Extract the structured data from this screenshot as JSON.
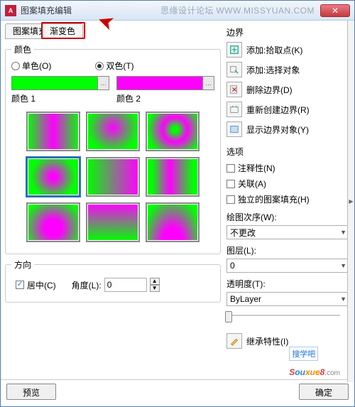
{
  "title": "图案填充编辑",
  "watermark_label": "思缘设计论坛",
  "watermark_url": "WWW.MISSYUAN.COM",
  "tabs": {
    "pattern": "图案填充",
    "gradient": "渐变色"
  },
  "color_group": {
    "legend": "颜色",
    "one_color": "单色(O)",
    "two_color": "双色(T)",
    "color1_label": "颜色 1",
    "color2_label": "颜色 2",
    "color1": "#00ff00",
    "color2": "#ff00ff"
  },
  "direction_group": {
    "legend": "方向",
    "center": "居中(C)",
    "angle_label": "角度(L):",
    "angle_value": "0"
  },
  "boundary": {
    "title": "边界",
    "add_pick": "添加:拾取点(K)",
    "add_select": "添加:选择对象",
    "remove": "删除边界(D)",
    "recreate": "重新创建边界(R)",
    "view": "显示边界对象(Y)"
  },
  "options": {
    "title": "选项",
    "annotative": "注释性(N)",
    "associative": "关联(A)",
    "separate": "独立的图案填充(H)",
    "draw_order_label": "绘图次序(W):",
    "draw_order_value": "不更改",
    "layer_label": "图层(L):",
    "layer_value": "0",
    "transparency_label": "透明度(T):",
    "transparency_value": "ByLayer"
  },
  "inherit": "继承特性(I)",
  "footer": {
    "preview": "预览",
    "ok": "确定"
  },
  "logo": {
    "text1": "搜学吧",
    "text2": "Souxue8",
    "suffix": ".com"
  }
}
